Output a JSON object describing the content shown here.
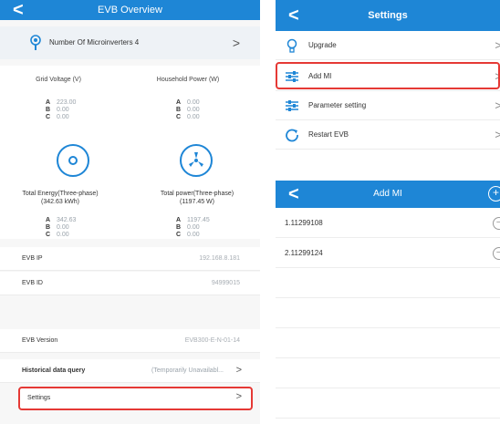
{
  "overview": {
    "title": "EVB Overview",
    "mi_count_label": "Number Of Microinverters 4",
    "grid_voltage_label": "Grid Voltage  (V)",
    "household_power_label": "Household Power  (W)",
    "grid_voltage": [
      {
        "phase": "A",
        "value": "223.00"
      },
      {
        "phase": "B",
        "value": "0.00"
      },
      {
        "phase": "C",
        "value": "0.00"
      }
    ],
    "household_power": [
      {
        "phase": "A",
        "value": "0.00"
      },
      {
        "phase": "B",
        "value": "0.00"
      },
      {
        "phase": "C",
        "value": "0.00"
      }
    ],
    "total_energy_label": "Total Energy(Three-phase)",
    "total_energy_value": "(342.63 kWh)",
    "total_power_label": "Total power(Three-phase)",
    "total_power_value": "(1197.45 W)",
    "total_energy": [
      {
        "phase": "A",
        "value": "342.63"
      },
      {
        "phase": "B",
        "value": "0.00"
      },
      {
        "phase": "C",
        "value": "0.00"
      }
    ],
    "total_power": [
      {
        "phase": "A",
        "value": "1197.45"
      },
      {
        "phase": "B",
        "value": "0.00"
      },
      {
        "phase": "C",
        "value": "0.00"
      }
    ],
    "info": [
      {
        "key": "EVB IP",
        "value": "192.168.8.181"
      },
      {
        "key": "EVB ID",
        "value": "94999015"
      },
      {
        "key": "EVB Version",
        "value": "EVB300-E-N-01-14"
      }
    ],
    "historical_label": "Historical data query",
    "historical_value": "(Temporarily Unavailabl...",
    "settings_label": "Settings"
  },
  "settings": {
    "title": "Settings",
    "items": [
      {
        "label": "Upgrade"
      },
      {
        "label": "Add MI"
      },
      {
        "label": "Parameter setting"
      },
      {
        "label": "Restart EVB"
      }
    ]
  },
  "addmi": {
    "title": "Add MI",
    "items": [
      {
        "label": "1.11299108"
      },
      {
        "label": "2.11299124"
      }
    ]
  },
  "glyphs": {
    "back": "<",
    "chevron": ">",
    "plus": "+",
    "minus": "−"
  },
  "colors": {
    "nav_blue": "#1e86d6",
    "highlight_red": "#e53935"
  }
}
